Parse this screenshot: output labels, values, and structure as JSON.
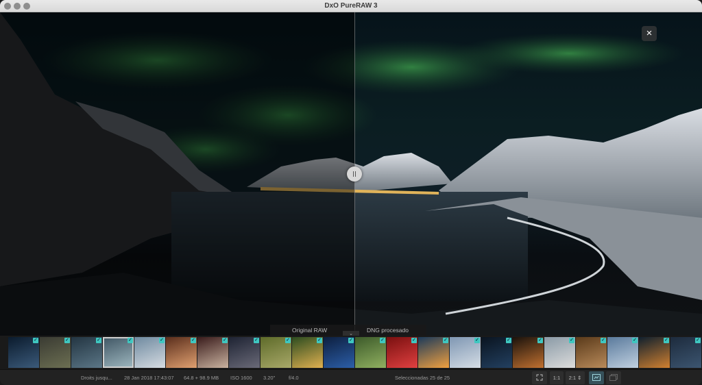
{
  "window": {
    "title": "DxO PureRAW 3"
  },
  "viewer": {
    "close_label": "×",
    "left_label": "Original RAW",
    "right_label": "DNG procesado",
    "collapse_label": "⌄"
  },
  "filmstrip": {
    "thumbnails": [
      {
        "colors": [
          "#0b1b2d",
          "#3b5a7a"
        ],
        "checked": true
      },
      {
        "colors": [
          "#3a3b33",
          "#6c6f52"
        ],
        "checked": true
      },
      {
        "colors": [
          "#233542",
          "#5b7686"
        ],
        "checked": true
      },
      {
        "colors": [
          "#3f5563",
          "#9fb8c0"
        ],
        "checked": true,
        "selected": true
      },
      {
        "colors": [
          "#6f8aa0",
          "#d5dbe1"
        ],
        "checked": true
      },
      {
        "colors": [
          "#5a2e1c",
          "#e0a070"
        ],
        "checked": true
      },
      {
        "colors": [
          "#3a1c1c",
          "#c9b29f"
        ],
        "checked": true
      },
      {
        "colors": [
          "#1e2333",
          "#6a6a78"
        ],
        "checked": true
      },
      {
        "colors": [
          "#5e6b2a",
          "#a8a868"
        ],
        "checked": true
      },
      {
        "colors": [
          "#2c4c20",
          "#e0b050"
        ],
        "checked": true
      },
      {
        "colors": [
          "#0d1f3f",
          "#2c5ea8"
        ],
        "checked": true
      },
      {
        "colors": [
          "#3c5a2a",
          "#90b060"
        ],
        "checked": true
      },
      {
        "colors": [
          "#7a1010",
          "#e04040"
        ],
        "checked": true
      },
      {
        "colors": [
          "#1c3a5a",
          "#f0a040"
        ],
        "checked": true
      },
      {
        "colors": [
          "#7f97b3",
          "#d5dde5"
        ],
        "checked": true
      },
      {
        "colors": [
          "#0a1420",
          "#234060"
        ],
        "checked": true
      },
      {
        "colors": [
          "#1a120c",
          "#c07030"
        ],
        "checked": true
      },
      {
        "colors": [
          "#8a9aa6",
          "#dcdcdc"
        ],
        "checked": true
      },
      {
        "colors": [
          "#5a3a1a",
          "#b88a5a"
        ],
        "checked": true
      },
      {
        "colors": [
          "#5a7a9c",
          "#c0d0e0"
        ],
        "checked": true
      },
      {
        "colors": [
          "#10202e",
          "#d08030"
        ],
        "checked": true
      },
      {
        "colors": [
          "#1d2b3d",
          "#3c5570"
        ],
        "checked": true
      }
    ]
  },
  "status": {
    "copyright": "Droits jusqu...",
    "datetime": "28 Jan 2018 17:43:07",
    "filesize": "64.8 + 98.9 MB",
    "iso": "ISO 1600",
    "shutter": "3.20\"",
    "aperture": "f/4.0",
    "selection": "Seleccionadas 25 de 25",
    "zoom_1": "1:1",
    "zoom_2": "2:1",
    "fit_icon": "fit-screen-icon",
    "compare_icon": "side-by-side-icon",
    "single_icon": "single-view-icon",
    "accent": "#3fc7c0"
  }
}
